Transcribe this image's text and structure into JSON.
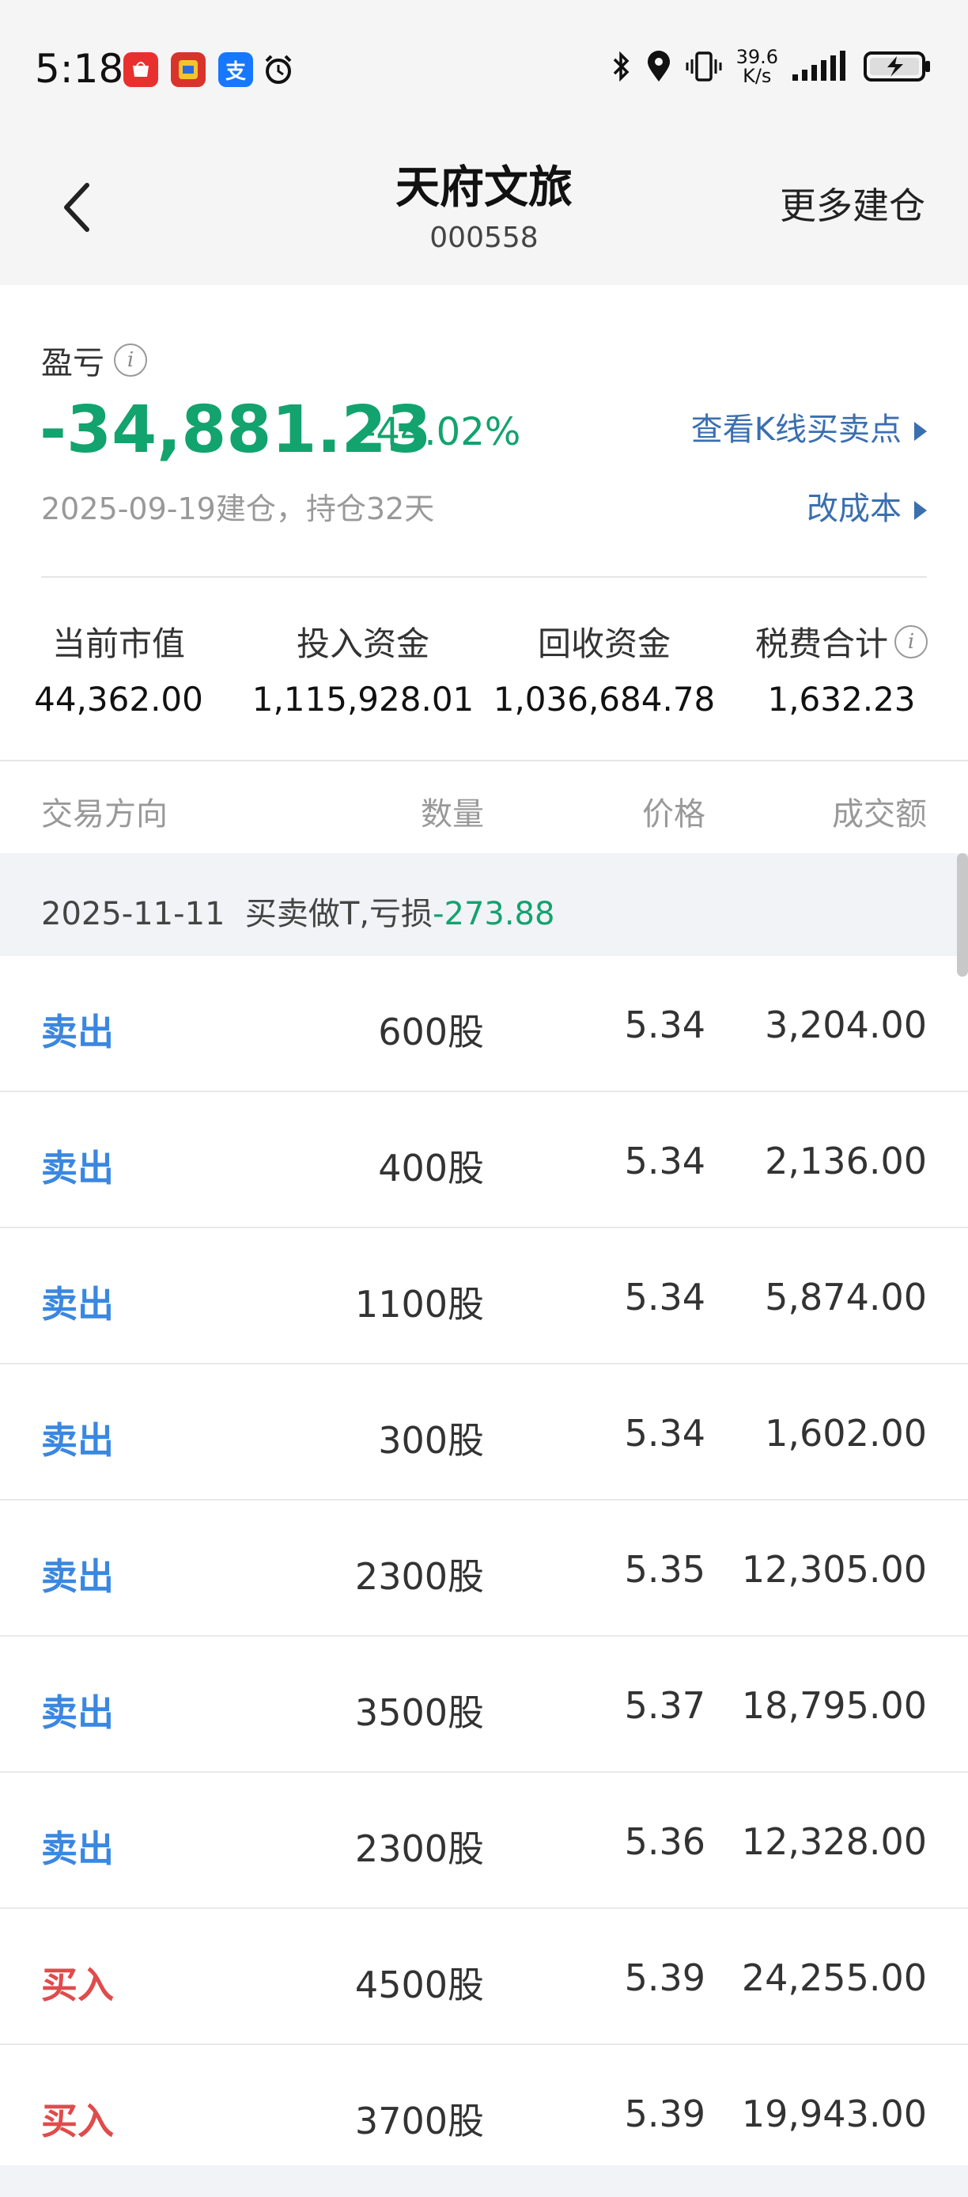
{
  "status_bar": {
    "time": "5:18",
    "speed_value": "39.6",
    "speed_unit": "K/s",
    "icons": [
      "huawei-app-icon",
      "game-app-icon",
      "alipay-icon",
      "alarm-icon",
      "bluetooth-icon",
      "location-icon",
      "vibrate-icon",
      "signal-icon",
      "battery-icon"
    ],
    "alipay_label": "支"
  },
  "nav": {
    "title": "天府文旅",
    "code": "000558",
    "more_label": "更多建仓"
  },
  "summary": {
    "pl_label": "盈亏",
    "info_glyph": "i",
    "pl_value": "-34,881.23",
    "pl_percent": "-44.02%",
    "kline_link": "查看K线买卖点",
    "cost_link": "改成本",
    "open_date": "2025-09-19建仓，持仓32天",
    "stats": [
      {
        "label": "当前市值",
        "value": "44,362.00"
      },
      {
        "label": "投入资金",
        "value": "1,115,928.01"
      },
      {
        "label": "回收资金",
        "value": "1,036,684.78"
      },
      {
        "label": "税费合计",
        "value": "1,632.23"
      }
    ]
  },
  "columns": {
    "direction": "交易方向",
    "quantity": "数量",
    "price": "价格",
    "amount": "成交额"
  },
  "group": {
    "date": "2025-11-11",
    "desc": "买卖做T,亏损",
    "loss": "-273.88"
  },
  "colors": {
    "profit_green": "#12a36e",
    "sell_blue": "#3a87e0",
    "buy_red": "#e04b4b",
    "link_blue": "#3a6fb0"
  },
  "trades": [
    {
      "direction": "卖出",
      "type": "sell",
      "quantity": "600股",
      "price": "5.34",
      "amount": "3,204.00"
    },
    {
      "direction": "卖出",
      "type": "sell",
      "quantity": "400股",
      "price": "5.34",
      "amount": "2,136.00"
    },
    {
      "direction": "卖出",
      "type": "sell",
      "quantity": "1100股",
      "price": "5.34",
      "amount": "5,874.00"
    },
    {
      "direction": "卖出",
      "type": "sell",
      "quantity": "300股",
      "price": "5.34",
      "amount": "1,602.00"
    },
    {
      "direction": "卖出",
      "type": "sell",
      "quantity": "2300股",
      "price": "5.35",
      "amount": "12,305.00"
    },
    {
      "direction": "卖出",
      "type": "sell",
      "quantity": "3500股",
      "price": "5.37",
      "amount": "18,795.00"
    },
    {
      "direction": "卖出",
      "type": "sell",
      "quantity": "2300股",
      "price": "5.36",
      "amount": "12,328.00"
    },
    {
      "direction": "买入",
      "type": "buy",
      "quantity": "4500股",
      "price": "5.39",
      "amount": "24,255.00"
    },
    {
      "direction": "买入",
      "type": "buy",
      "quantity": "3700股",
      "price": "5.39",
      "amount": "19,943.00"
    }
  ]
}
